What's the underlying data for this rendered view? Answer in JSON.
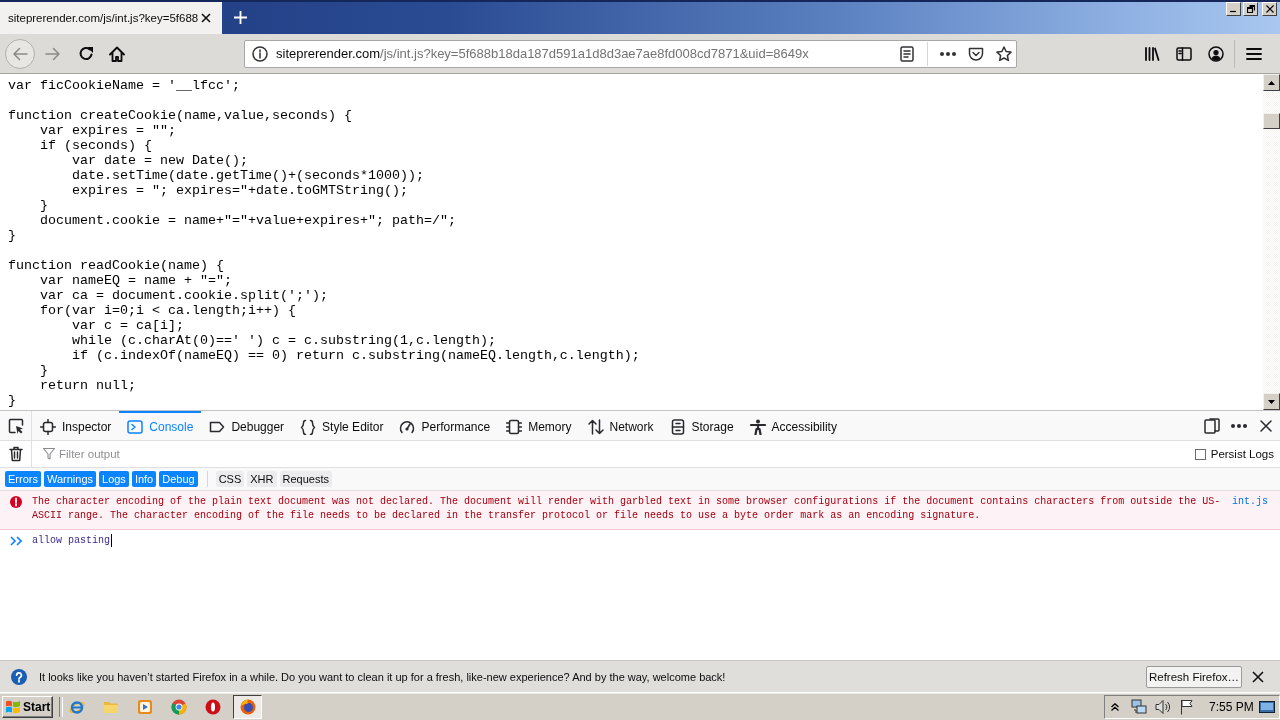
{
  "tabs": [
    {
      "title": "siteprerender.com/js/int.js?key=5f688",
      "selected": true
    }
  ],
  "navigation": {
    "back": {
      "disabled": true
    },
    "forward": {
      "disabled": true
    }
  },
  "address_bar": {
    "host": "siteprerender.com",
    "path": "/js/int.js?key=5f688b18da187d591a1d8d3ae7ae8fd008cd7871&uid=8649x"
  },
  "page": {
    "code_blocks": [
      [
        "var ficCookieName = '__lfcc';"
      ],
      [
        "function createCookie(name,value,seconds) {",
        "    var expires = \"\";",
        "    if (seconds) {",
        "        var date = new Date();",
        "        date.setTime(date.getTime()+(seconds*1000));",
        "        expires = \"; expires=\"+date.toGMTString();",
        "    }",
        "    document.cookie = name+\"=\"+value+expires+\"; path=/\";",
        "}"
      ],
      [
        "function readCookie(name) {",
        "    var nameEQ = name + \"=\";",
        "    var ca = document.cookie.split(';');",
        "    for(var i=0;i < ca.length;i++) {",
        "        var c = ca[i];",
        "        while (c.charAt(0)==' ') c = c.substring(1,c.length);",
        "        if (c.indexOf(nameEQ) == 0) return c.substring(nameEQ.length,c.length);",
        "    }",
        "    return null;",
        "}"
      ]
    ]
  },
  "devtools": {
    "tabs": [
      {
        "kind": "inspector",
        "label": "Inspector",
        "selected": false
      },
      {
        "kind": "console",
        "label": "Console",
        "selected": true
      },
      {
        "kind": "debugger",
        "label": "Debugger",
        "selected": false
      },
      {
        "kind": "styles",
        "label": "Style Editor",
        "selected": false
      },
      {
        "kind": "performance",
        "label": "Performance",
        "selected": false
      },
      {
        "kind": "memory",
        "label": "Memory",
        "selected": false
      },
      {
        "kind": "network",
        "label": "Network",
        "selected": false
      },
      {
        "kind": "storage",
        "label": "Storage",
        "selected": false
      },
      {
        "kind": "accessibility",
        "label": "Accessibility",
        "selected": false
      }
    ],
    "filter": {
      "placeholder": "Filter output"
    },
    "persist_logs": {
      "label": "Persist Logs",
      "checked": false
    },
    "level_filters": [
      {
        "label": "Errors",
        "selected": true
      },
      {
        "label": "Warnings",
        "selected": true
      },
      {
        "label": "Logs",
        "selected": true
      },
      {
        "label": "Info",
        "selected": true
      },
      {
        "label": "Debug",
        "selected": true
      }
    ],
    "type_filters": [
      {
        "label": "CSS",
        "selected": false
      },
      {
        "label": "XHR",
        "selected": false
      },
      {
        "label": "Requests",
        "selected": false
      }
    ],
    "messages": [
      {
        "kind": "error",
        "text": "The character encoding of the plain text document was not declared. The document will render with garbled text in some browser configurations if the document contains characters from outside the US-ASCII range. The character encoding of the file needs to be declared in the transfer protocol or file needs to use a byte order mark as an encoding signature.",
        "source": "int.js"
      }
    ],
    "input": {
      "value": "allow pasting"
    }
  },
  "notification": {
    "text": "It looks like you haven’t started Firefox in a while. Do you want to clean it up for a fresh, like-new experience? And by the way, welcome back!",
    "button": "Refresh Firefox…"
  },
  "taskbar": {
    "start": "Start",
    "quick_launch": [
      {
        "kind": "letter"
      },
      {
        "kind": "folder"
      },
      {
        "kind": "player"
      },
      {
        "kind": "wheel"
      },
      {
        "kind": "ring"
      }
    ],
    "windows": [
      {
        "kind": "fox",
        "selected": true
      }
    ],
    "clock": "7:55 PM"
  }
}
